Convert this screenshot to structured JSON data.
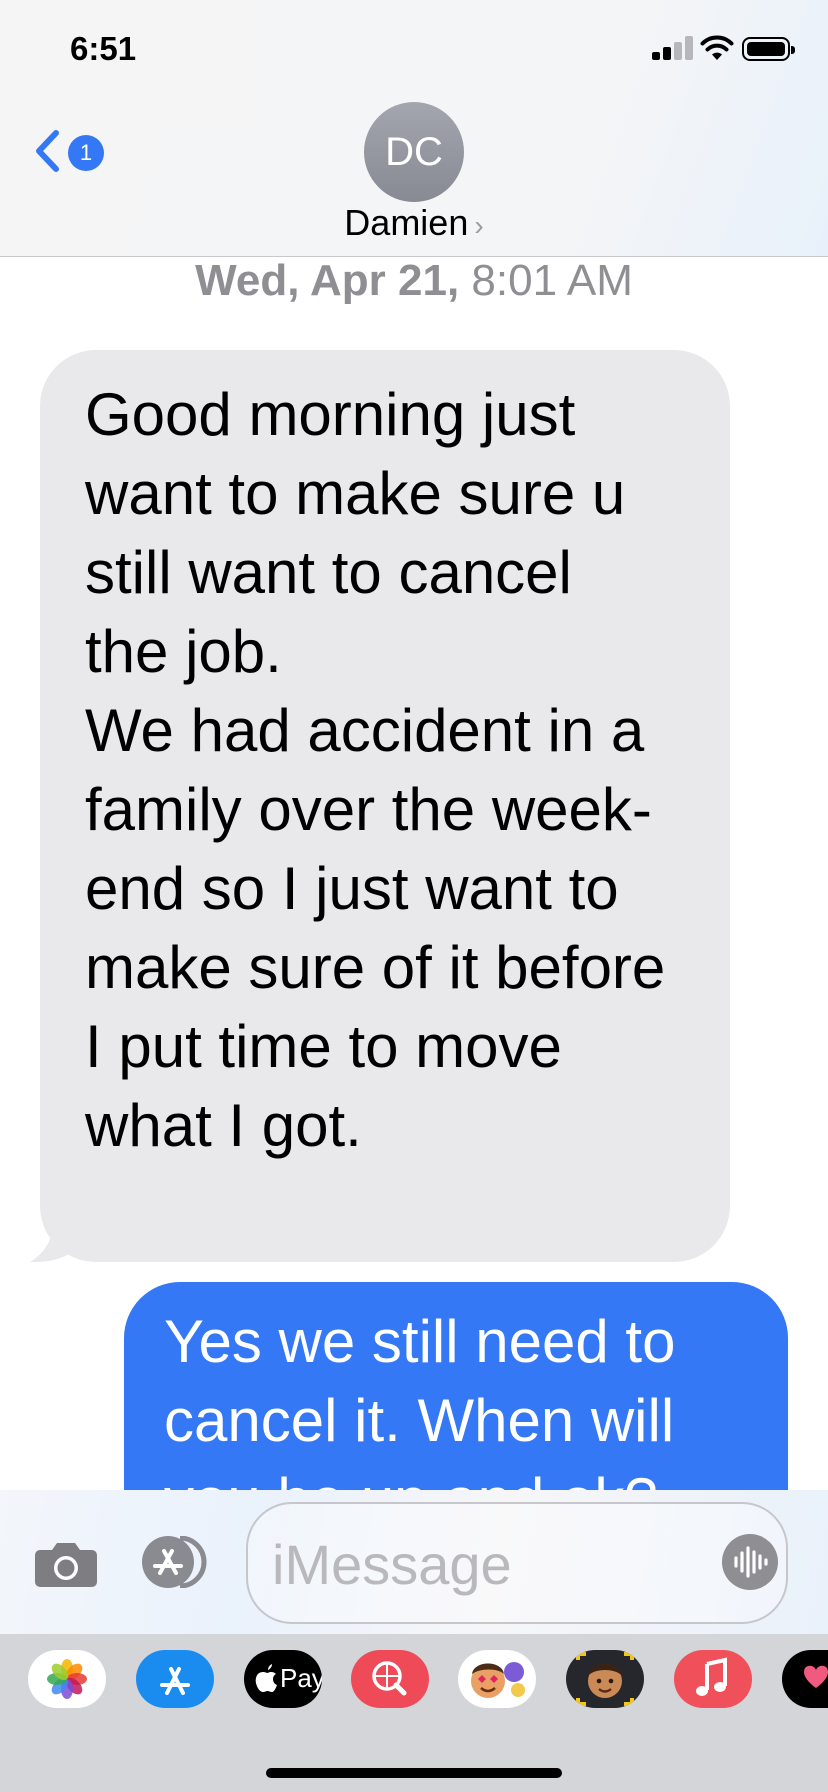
{
  "status_bar": {
    "time": "6:51",
    "signal_icon": "cellular-signal-icon",
    "wifi_icon": "wifi-icon",
    "battery_icon": "battery-icon"
  },
  "header": {
    "back_badge_count": "1",
    "avatar_initials": "DC",
    "contact_name": "Damien",
    "contact_chevron": "›"
  },
  "conversation": {
    "timestamp_day": "Wed, Apr 21,",
    "timestamp_time": " 8:01 AM",
    "messages": [
      {
        "direction": "incoming",
        "lines": [
          "Good morning just",
          "want to make sure u",
          "still want to cancel",
          "the job.",
          "We had accident in a",
          "family over the week-",
          "end so I just want to",
          "make sure of it before",
          "I put time to move",
          "what I got."
        ]
      },
      {
        "direction": "outgoing",
        "lines": [
          "Yes we still need to",
          "cancel it. When will",
          "you be up and ok?"
        ]
      }
    ]
  },
  "compose": {
    "placeholder": "iMessage",
    "camera_icon": "camera-icon",
    "apps_icon": "app-store-icon",
    "mic_icon": "audio-waveform-icon"
  },
  "app_strip": {
    "apps": [
      "Photos",
      "App Store",
      "Pay",
      "Web Search",
      "Memoji Stickers",
      "Memoji",
      "Music",
      "Digital Touch"
    ],
    "apple_pay_label": "Pay"
  },
  "colors": {
    "accent_blue": "#3478f6",
    "incoming_bubble": "#e9e9eb",
    "secondary_text": "#8e8e93"
  }
}
